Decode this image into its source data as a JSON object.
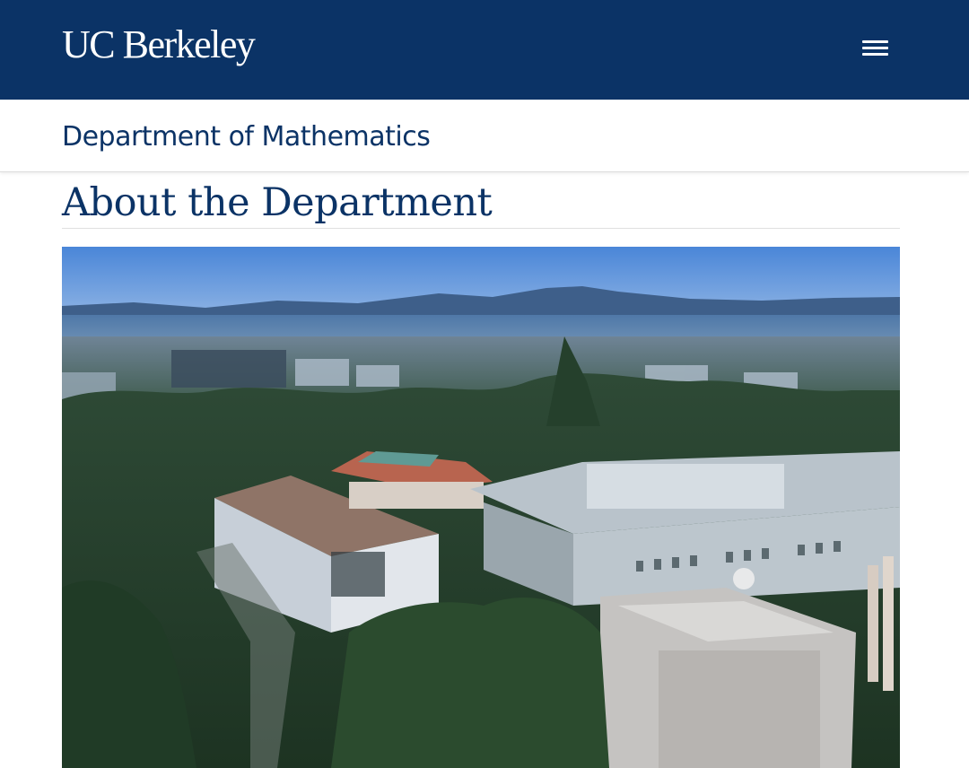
{
  "header": {
    "brand": "UC Berkeley",
    "menu_icon": "hamburger-menu-icon",
    "background_color": "#0b3366"
  },
  "department": {
    "name": "Department of Mathematics"
  },
  "main": {
    "title": "About the Department",
    "hero_image": {
      "subject": "aerial-campus-photo"
    }
  },
  "colors": {
    "brand_navy": "#0b3366",
    "text_navy": "#0b3366",
    "white": "#ffffff"
  }
}
